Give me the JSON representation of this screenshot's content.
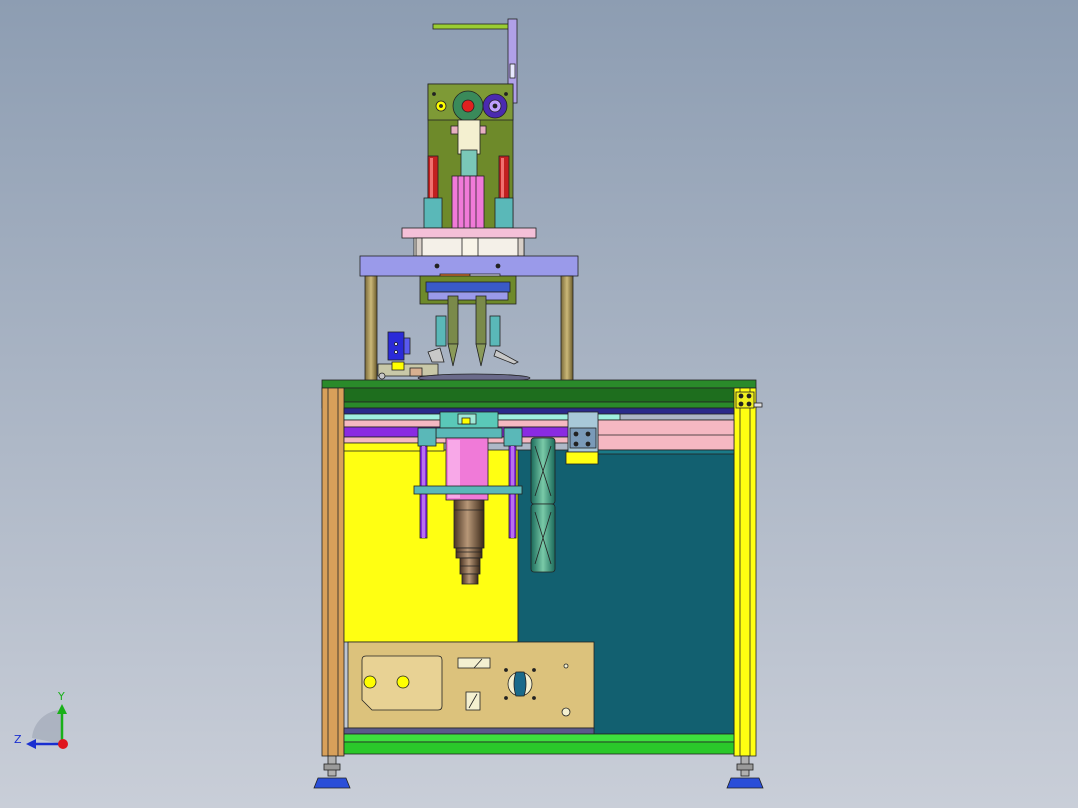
{
  "viewport": {
    "background_top": "#8d9db2",
    "background_bottom": "#c9ced8"
  },
  "triad": {
    "y_label": "Y",
    "z_label": "Z",
    "y_color": "#19b019",
    "z_color": "#1a2fd0",
    "x_color": "#e0141e"
  },
  "colors": {
    "frame_wood": "#d8a05a",
    "frame_yellow": "#ffff12",
    "top_plate_green": "#2a8a2a",
    "bottom_rail_green": "#3de03d",
    "rail_pink": "#f5b8c2",
    "rail_purple": "#8a2be2",
    "panel_teal": "#126070",
    "control_box": "#dcc27c",
    "upper_plate": "#9a9aea",
    "head_plate_olive": "#6e8a2a",
    "cylinder_red": "#c22020",
    "cylinder_teal": "#5ab8b8",
    "motor_pink": "#f07ad8",
    "spindle_bronze": "#8a6a48",
    "foot_blue": "#2a4ed8"
  }
}
